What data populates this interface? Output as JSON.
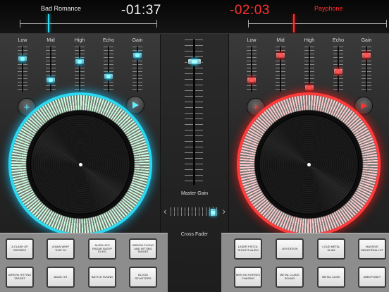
{
  "left_deck": {
    "track": "Bad Romance",
    "time": "-01:37",
    "accent": "#2ad8f0",
    "eq": [
      {
        "label": "Low",
        "level": 0.24
      },
      {
        "label": "Mid",
        "level": 0.76
      },
      {
        "label": "High",
        "level": 0.3
      },
      {
        "label": "Echo",
        "level": 0.68
      },
      {
        "label": "Gain",
        "level": 0.15
      }
    ],
    "add_icon": "plus-icon",
    "play_icon": "play-icon",
    "pads": [
      "A CLASH OF SWORDS",
      "A MAN WHIP THAT DJ",
      "ALIEN UFO RADAR BLEEP ECHO",
      "ARROW FLYING AND HITTING TARGET",
      "ARROW HITTING TARGET",
      "BANG HIT",
      "BATTLE SOUND",
      "BLOOD SPLATTERS"
    ]
  },
  "right_deck": {
    "track": "Payphone",
    "time": "-02:03",
    "accent": "#ff3b3b",
    "eq": [
      {
        "label": "Low",
        "level": 0.76
      },
      {
        "label": "Mid",
        "level": 0.15
      },
      {
        "label": "High",
        "level": 0.97
      },
      {
        "label": "Echo",
        "level": 0.55
      },
      {
        "label": "Gain",
        "level": 0.15
      }
    ],
    "add_icon": "plus-icon",
    "play_icon": "play-icon",
    "pads": [
      "LASER PISTOL SHOOTS ALIEN",
      "LEVITATION",
      "LOUD METAL SLAM",
      "MASSIVE INDUSTRIAL HIT",
      "MEN ON HORSES CHASING",
      "METAL CLANG SOUND",
      "METAL CLINK",
      "MMM FUNKY"
    ]
  },
  "mixer": {
    "master_gain_label": "Master Gain",
    "master_gain_level": 0.86,
    "cross_fader_label": "Cross Fader",
    "cross_fader_position": 0.9
  }
}
